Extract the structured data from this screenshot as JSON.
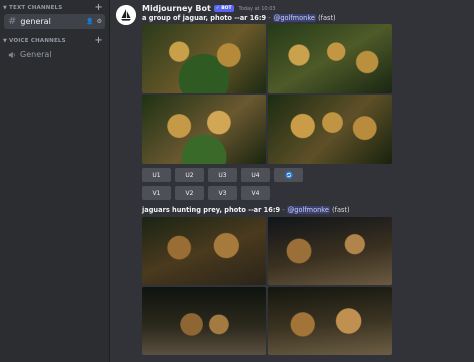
{
  "sidebar": {
    "text_category": "TEXT CHANNELS",
    "voice_category": "VOICE CHANNELS",
    "text_channels": [
      {
        "name": "general"
      }
    ],
    "voice_channels": [
      {
        "name": "General"
      }
    ],
    "icons": {
      "add": "plus-icon",
      "invite": "add-member-icon",
      "settings": "gear-icon"
    }
  },
  "message": {
    "author": "Midjourney Bot",
    "badge": "✓ BOT",
    "timestamp": "Today at 10:03",
    "result1": {
      "prompt": "a group of jaguar, photo --ar 16:9",
      "separator": "-",
      "mention": "@golfmonke",
      "mode": "(fast)"
    },
    "buttons_upscale": [
      "U1",
      "U2",
      "U3",
      "U4"
    ],
    "buttons_variation": [
      "V1",
      "V2",
      "V3",
      "V4"
    ],
    "reroll_icon": "refresh-icon",
    "result2": {
      "prompt": "jaguars hunting prey, photo --ar 16:9",
      "separator": "-",
      "mention": "@golfmonke",
      "mode": "(fast)"
    }
  },
  "colors": {
    "accent": "#5865f2",
    "background": "#313338",
    "sidebar": "#2b2d31"
  }
}
